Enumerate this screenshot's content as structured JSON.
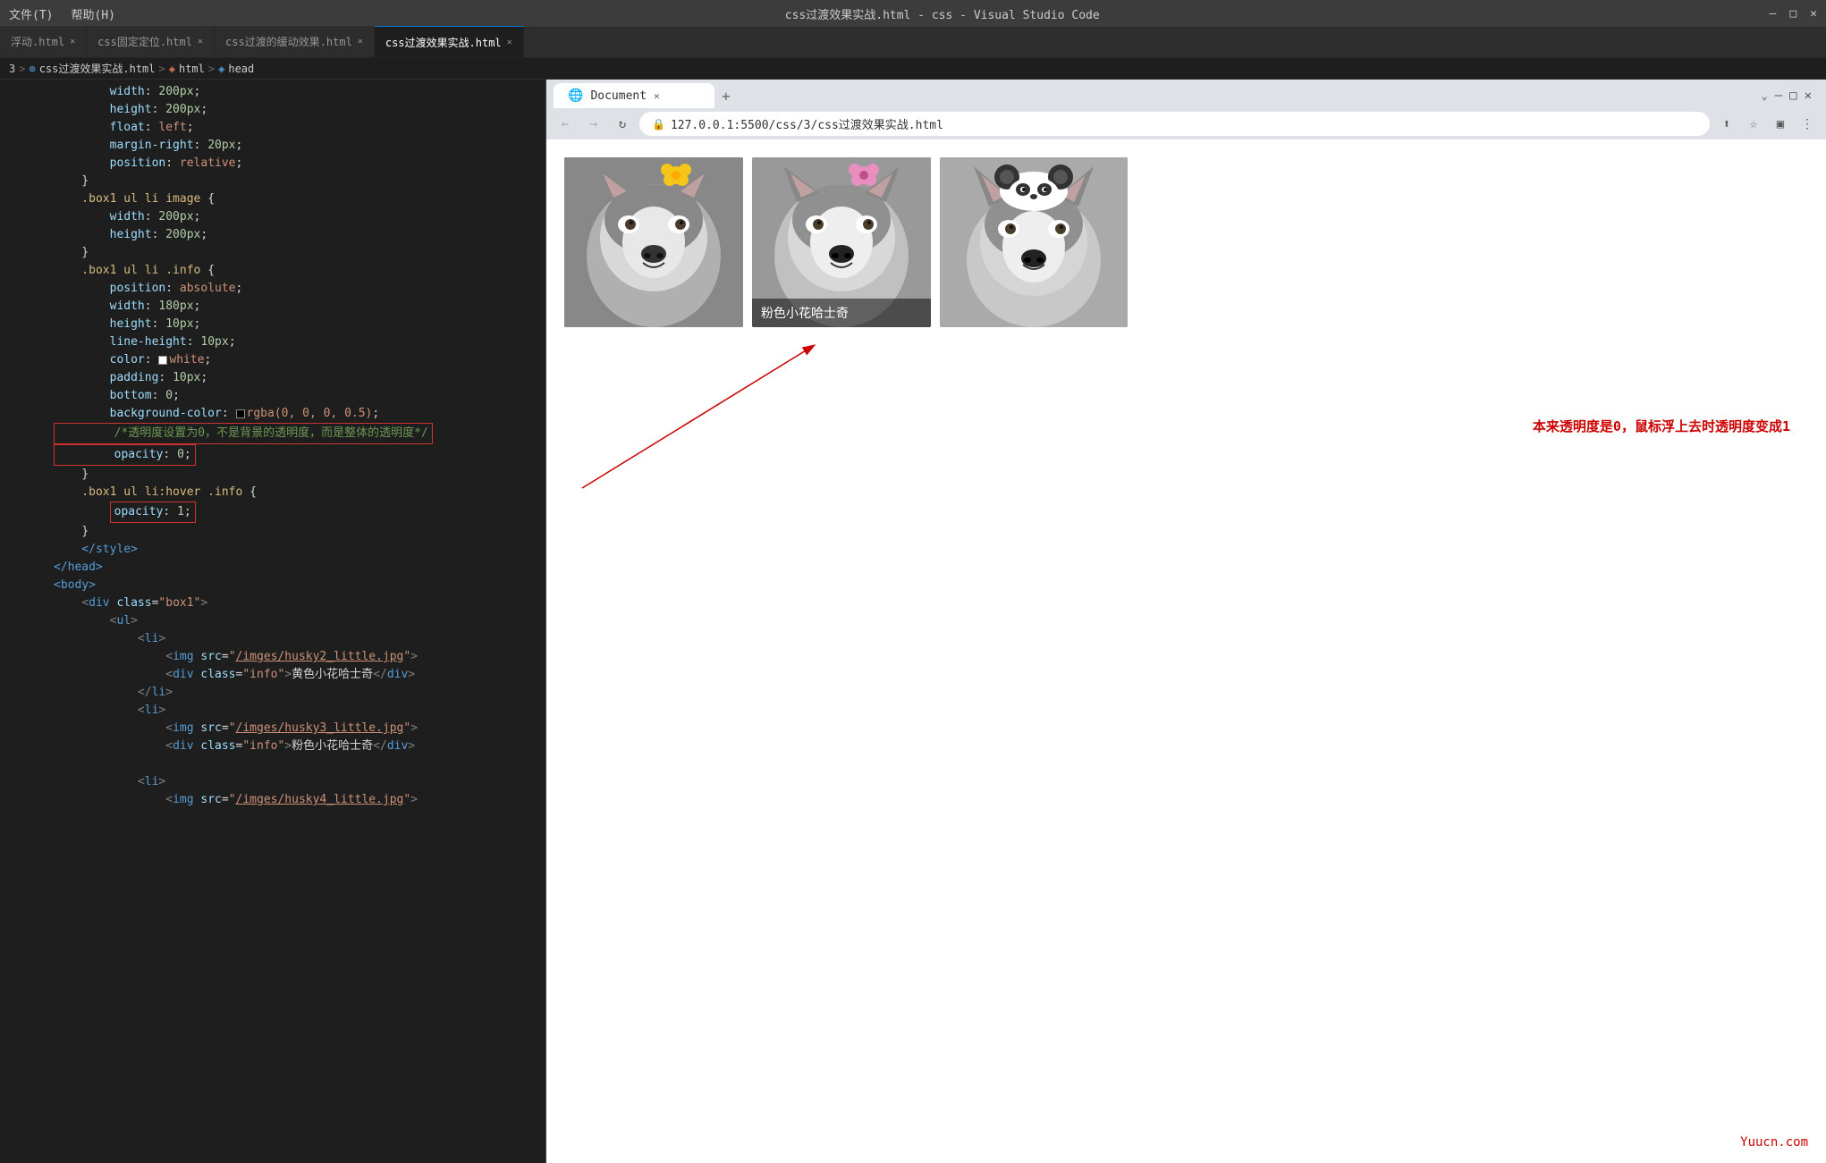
{
  "titleBar": {
    "menu": [
      "文件(T)",
      "帮助(H)"
    ],
    "title": "css过渡效果实战.html - css - Visual Studio Code",
    "controls": [
      "—",
      "□",
      "✕"
    ]
  },
  "tabs": [
    {
      "id": "tab1",
      "label": "浮动.html",
      "active": false,
      "dot": false
    },
    {
      "id": "tab2",
      "label": "css固定定位.html",
      "active": false,
      "dot": false
    },
    {
      "id": "tab3",
      "label": "css过渡的缓动效果.html",
      "active": false,
      "dot": false
    },
    {
      "id": "tab4",
      "label": "css过渡效果实战.html",
      "active": true,
      "dot": false
    }
  ],
  "breadcrumb": {
    "items": [
      "3",
      ">",
      "css过渡效果实战.html",
      ">",
      "html",
      ">",
      "head"
    ]
  },
  "browser": {
    "tabLabel": "Document",
    "url": "127.0.0.1:5500/css/3/css过渡效果实战.html",
    "newTabIcon": "+",
    "closeIcon": "✕"
  },
  "codeLines": [
    {
      "num": "",
      "code": "        width: 200px;"
    },
    {
      "num": "",
      "code": "        height: 200px;"
    },
    {
      "num": "",
      "code": "        float: left;"
    },
    {
      "num": "",
      "code": "        margin-right: 20px;"
    },
    {
      "num": "",
      "code": "        position: relative;"
    },
    {
      "num": "",
      "code": "    }"
    },
    {
      "num": "",
      "code": "    .box1 ul li image {"
    },
    {
      "num": "",
      "code": "        width: 200px;"
    },
    {
      "num": "",
      "code": "        height: 200px;"
    },
    {
      "num": "",
      "code": "    }"
    },
    {
      "num": "",
      "code": "    .box1 ul li .info {"
    },
    {
      "num": "",
      "code": "        position: absolute;"
    },
    {
      "num": "",
      "code": "        width: 180px;"
    },
    {
      "num": "",
      "code": "        height: 10px;"
    },
    {
      "num": "",
      "code": "        line-height: 10px;"
    },
    {
      "num": "",
      "code": "        color: ☐white;"
    },
    {
      "num": "",
      "code": "        padding: 10px;"
    },
    {
      "num": "",
      "code": "        bottom: 0;"
    },
    {
      "num": "",
      "code": "        background-color: ■rgba(0, 0, 0, 0.5);"
    },
    {
      "num": "",
      "code": "        /*透明度设置为0，不是背景的透明度，而是整体的透明度*/"
    },
    {
      "num": "",
      "code": "        opacity: 0;"
    },
    {
      "num": "",
      "code": "    }"
    },
    {
      "num": "",
      "code": "    .box1 ul li:hover .info {"
    },
    {
      "num": "",
      "code": "        opacity: 1;"
    },
    {
      "num": "",
      "code": "    }"
    },
    {
      "num": "",
      "code": "    </style>"
    },
    {
      "num": "",
      "code": "</head>"
    },
    {
      "num": "",
      "code": "<body>"
    },
    {
      "num": "",
      "code": "    <div class=\"box1\">"
    },
    {
      "num": "",
      "code": "        <ul>"
    },
    {
      "num": "",
      "code": "            <li>"
    },
    {
      "num": "",
      "code": "                <img src=\"/imges/husky2_little.jpg\">"
    },
    {
      "num": "",
      "code": "                <div class=\"info\">黄色小花哈士奇</div>"
    },
    {
      "num": "",
      "code": "            </li>"
    },
    {
      "num": "",
      "code": "            <li>"
    },
    {
      "num": "",
      "code": "                <img src=\"/imges/husky3_little.jpg\">"
    },
    {
      "num": "",
      "code": "                <div class=\"info\">粉色小花哈士奇</div>"
    },
    {
      "num": "",
      "code": "            </li>"
    },
    {
      "num": "",
      "code": ""
    },
    {
      "num": "",
      "code": "            <li>"
    },
    {
      "num": "",
      "code": "                <img src=\"/imges/husky4_little.jpg\">"
    }
  ],
  "annotation": {
    "text": "本来透明度是0，鼠标浮上去时透明度变成1"
  },
  "dogs": [
    {
      "id": "dog1",
      "name": "",
      "showOverlay": false
    },
    {
      "id": "dog2",
      "name": "粉色小花哈士奇",
      "showOverlay": true
    },
    {
      "id": "dog3",
      "name": "",
      "showOverlay": false
    }
  ],
  "watermark": "Yuucn.com"
}
